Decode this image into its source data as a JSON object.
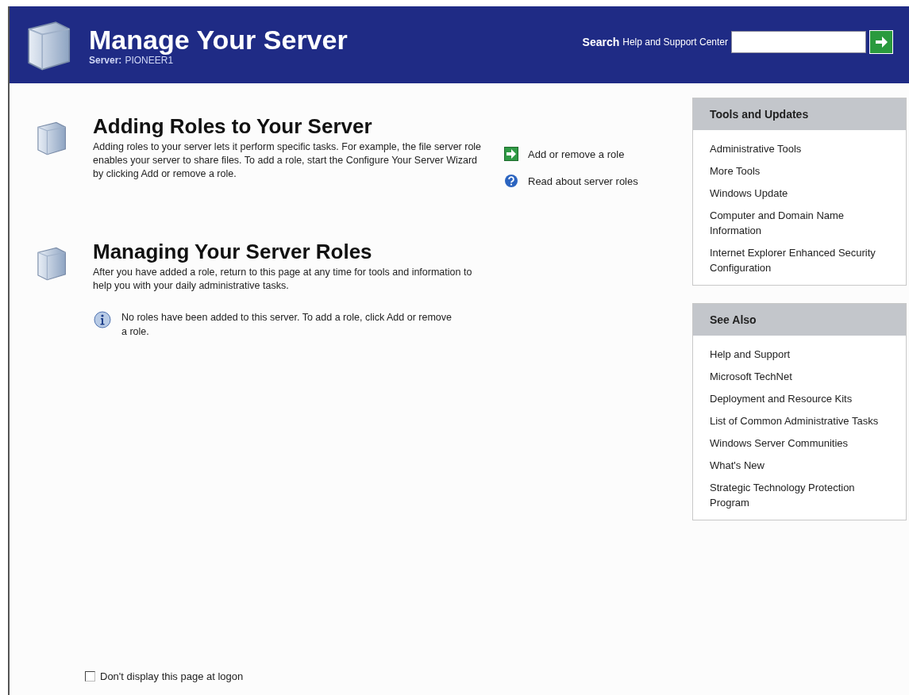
{
  "header": {
    "title": "Manage Your Server",
    "server_label": "Server:",
    "server_name": "PIONEER1",
    "search_label": "Search",
    "search_hint": "Help and Support Center"
  },
  "sections": [
    {
      "title": "Adding Roles to Your Server",
      "text": "Adding roles to your server lets it perform specific tasks. For example, the file server role enables your server to share files. To add a role, start the Configure Your Server Wizard by clicking Add or remove a role.",
      "links": [
        {
          "kind": "arrow",
          "label": "Add or remove a role"
        },
        {
          "kind": "help",
          "label": "Read about server roles"
        }
      ]
    },
    {
      "title": "Managing Your Server Roles",
      "text": "After you have added a role, return to this page at any time for tools and information to help you with your daily administrative tasks.",
      "note": "No roles have been added to this server. To add a role, click Add or remove a role."
    }
  ],
  "panels": [
    {
      "title": "Tools and Updates",
      "links": [
        "Administrative Tools",
        "More Tools",
        "Windows Update",
        "Computer and Domain Name Information",
        "Internet Explorer Enhanced Security Configuration"
      ]
    },
    {
      "title": "See Also",
      "links": [
        "Help and Support",
        "Microsoft TechNet",
        "Deployment and Resource Kits",
        "List of Common Administrative Tasks",
        "Windows Server Communities",
        "What's New",
        "Strategic Technology Protection Program"
      ]
    }
  ],
  "logon_checkbox": {
    "label": "Don't display this page at logon",
    "checked": false
  }
}
